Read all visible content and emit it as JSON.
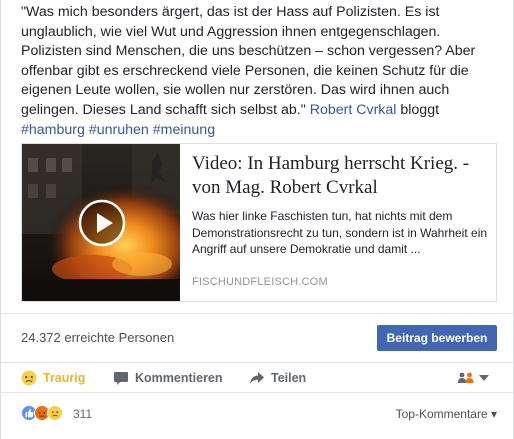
{
  "post": {
    "quote": "\"Was mich besonders ärgert, das ist der Hass auf Polizisten. Es ist unglaublich, wie viel Wut und Aggression ihnen entgegenschlagen. Polizisten sind Menschen, die uns beschützen – schon vergessen? Aber offenbar gibt es erschreckend viele Personen, die keinen Schutz für die eigenen Leute wollen, sie wollen nur zerstören. Das wird ihnen auch gelingen. Dieses Land schafft sich selbst ab.\" ",
    "author_link": "Robert Cvrkal",
    "author_suffix": " bloggt",
    "hashtags": [
      "#hamburg",
      "#unruhen",
      "#meinung"
    ]
  },
  "share": {
    "title": "Video: In Hamburg herrscht Krieg. - von Mag. Robert Cvrkal",
    "description": "Was hier linke Faschisten tun, hat nichts mit dem Demonstrationsrecht zu tun, sondern ist in Wahrheit ein Angriff auf unsere Demokratie und damit ...",
    "domain": "FISCHUNDFLEISCH.COM"
  },
  "reach": {
    "text": "24.372 erreichte Personen",
    "boost_label": "Beitrag bewerben"
  },
  "actions": {
    "sad_label": "Traurig",
    "comment_label": "Kommentieren",
    "share_label": "Teilen"
  },
  "reactions": {
    "count": "311",
    "top_comments_label": "Top-Kommentare ▾"
  },
  "colors": {
    "link": "#365899",
    "sad": "#e9b535",
    "button": "#4267b2",
    "like": "#5890ff",
    "angry": "#e9710f"
  },
  "icons": [
    "play-icon",
    "sad-icon",
    "comment-icon",
    "share-icon",
    "audience-icon",
    "caret-down-icon",
    "like-reaction-icon",
    "angry-reaction-icon",
    "sad-reaction-icon"
  ]
}
